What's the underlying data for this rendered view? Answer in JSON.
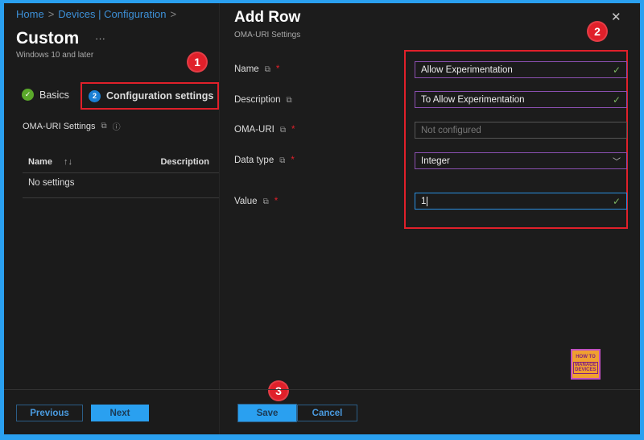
{
  "breadcrumb": {
    "home": "Home",
    "devices": "Devices | Configuration",
    "sep": ">"
  },
  "page": {
    "title": "Custom",
    "more": "···",
    "subtitle": "Windows 10 and later"
  },
  "steps": [
    {
      "num": "✓",
      "label": "Basics"
    },
    {
      "num": "2",
      "label": "Configuration settings"
    }
  ],
  "oma_section": {
    "label": "OMA-URI Settings"
  },
  "table": {
    "headers": [
      "Name",
      "Description"
    ],
    "sort_icon": "↑↓",
    "empty": "No settings"
  },
  "left_footer": {
    "previous": "Previous",
    "next": "Next"
  },
  "panel": {
    "title": "Add Row",
    "subtitle": "OMA-URI Settings",
    "close": "✕"
  },
  "fields": [
    {
      "label": "Name",
      "required": true,
      "value": "Allow Experimentation"
    },
    {
      "label": "Description",
      "required": false,
      "value": "To Allow Experimentation"
    },
    {
      "label": "OMA-URI",
      "required": true,
      "placeholder": "Not configured"
    },
    {
      "label": "Data type",
      "required": true,
      "value": "Integer"
    },
    {
      "label": "Value",
      "required": true,
      "value": "1"
    }
  ],
  "required_mark": "*",
  "right_footer": {
    "save": "Save",
    "cancel": "Cancel"
  },
  "annotations": [
    "1",
    "2",
    "3"
  ],
  "logo": {
    "line1": "HOW TO",
    "line2": "MANAGE",
    "line3": "DEVICES"
  },
  "colors": {
    "accent": "#2aa0f0",
    "annotation": "#e0202a",
    "valid": "#7bb661"
  }
}
